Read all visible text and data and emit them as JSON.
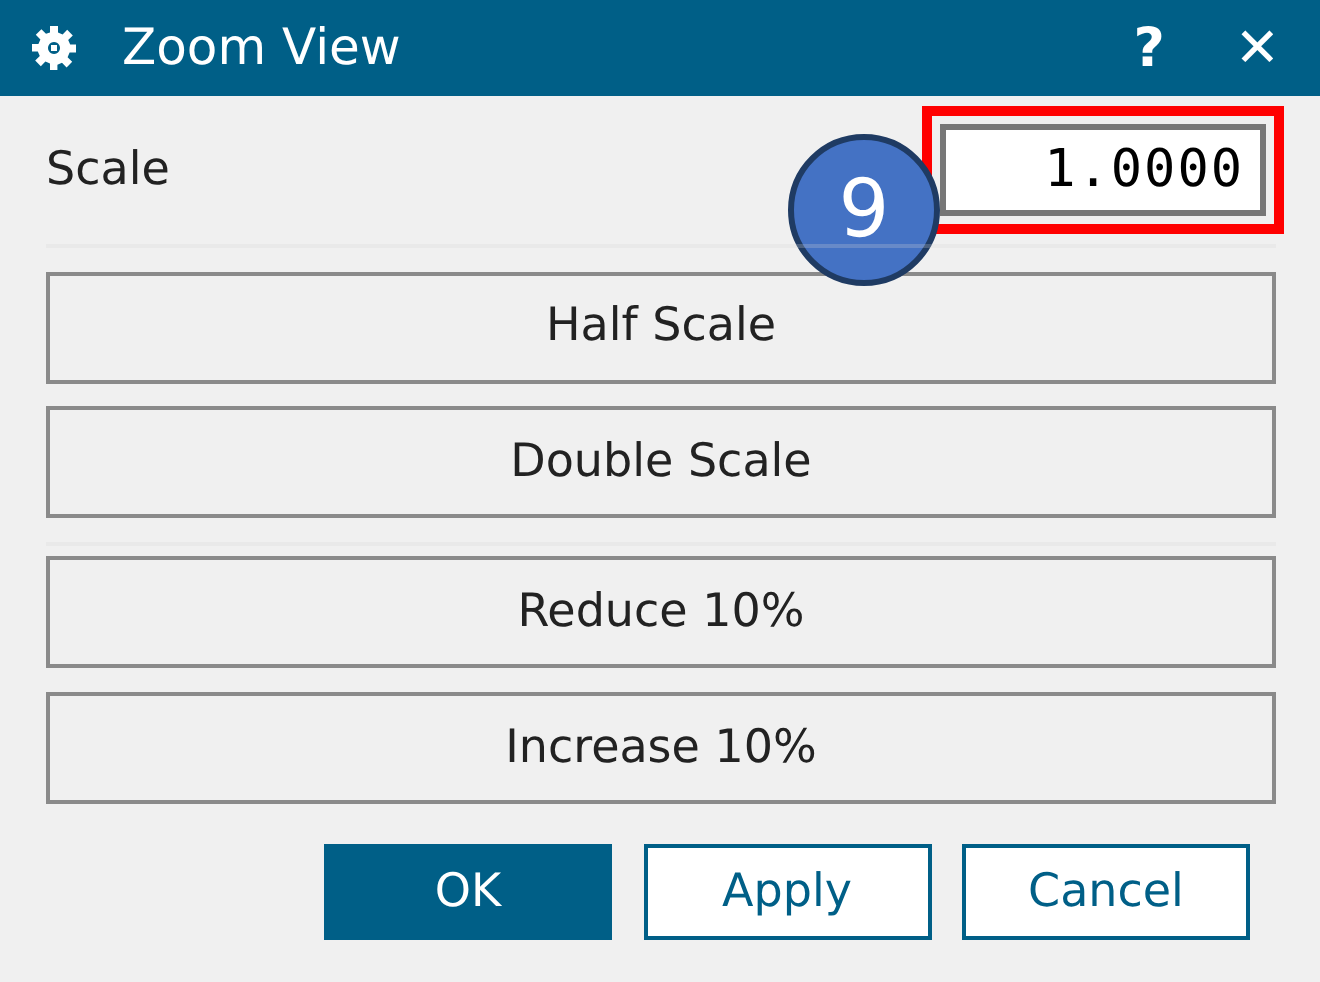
{
  "window": {
    "title": "Zoom View",
    "help": "?",
    "close": "✕"
  },
  "scale": {
    "label": "Scale",
    "value": "1.0000",
    "highlighted": true,
    "step_badge": "9"
  },
  "scale_buttons": [
    "Half Scale",
    "Double Scale"
  ],
  "step_buttons": [
    "Reduce 10%",
    "Increase 10%"
  ],
  "footer_buttons": [
    {
      "label": "OK",
      "primary": true
    },
    {
      "label": "Apply",
      "primary": false
    },
    {
      "label": "Cancel",
      "primary": false
    }
  ]
}
